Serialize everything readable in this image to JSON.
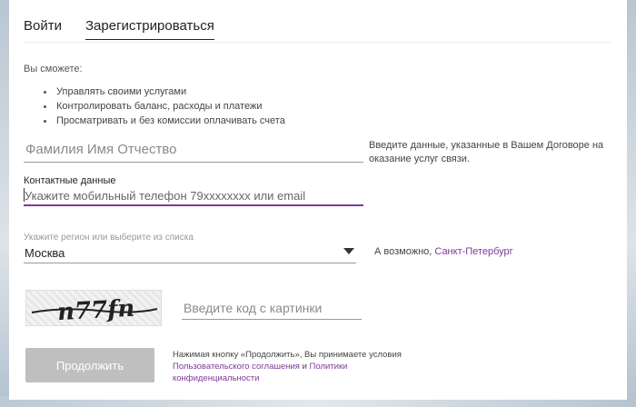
{
  "tabs": [
    {
      "label": "Войти",
      "active": false
    },
    {
      "label": "Зарегистрироваться",
      "active": true
    }
  ],
  "intro": "Вы сможете:",
  "benefits": [
    "Управлять своими услугами",
    "Контролировать баланс, расходы и платежи",
    "Просматривать и без комиссии оплачивать счета"
  ],
  "name_field": {
    "placeholder": "Фамилия Имя Отчество",
    "hint": "Введите данные, указанные в Вашем Договоре на оказание услуг связи."
  },
  "contact_field": {
    "label": "Контактные данные",
    "placeholder": "Укажите мобильный телефон 79xxxxxxxx или email"
  },
  "region_field": {
    "label": "Укажите регион или выберите из списка",
    "value": "Москва",
    "hint_prefix": "А возможно, ",
    "hint_link": "Санкт-Петербург"
  },
  "captcha": {
    "text": "n77fn",
    "placeholder": "Введите код с картинки"
  },
  "submit_label": "Продолжить",
  "terms": {
    "text_before": "Нажимая кнопку «Продолжить», Вы принимаете условия ",
    "link1": "Пользовательского соглашения",
    "and": " и ",
    "link2": "Политики конфиденциальности"
  },
  "colors": {
    "accent": "#7e3a98",
    "button_disabled": "#bfbfbf"
  }
}
